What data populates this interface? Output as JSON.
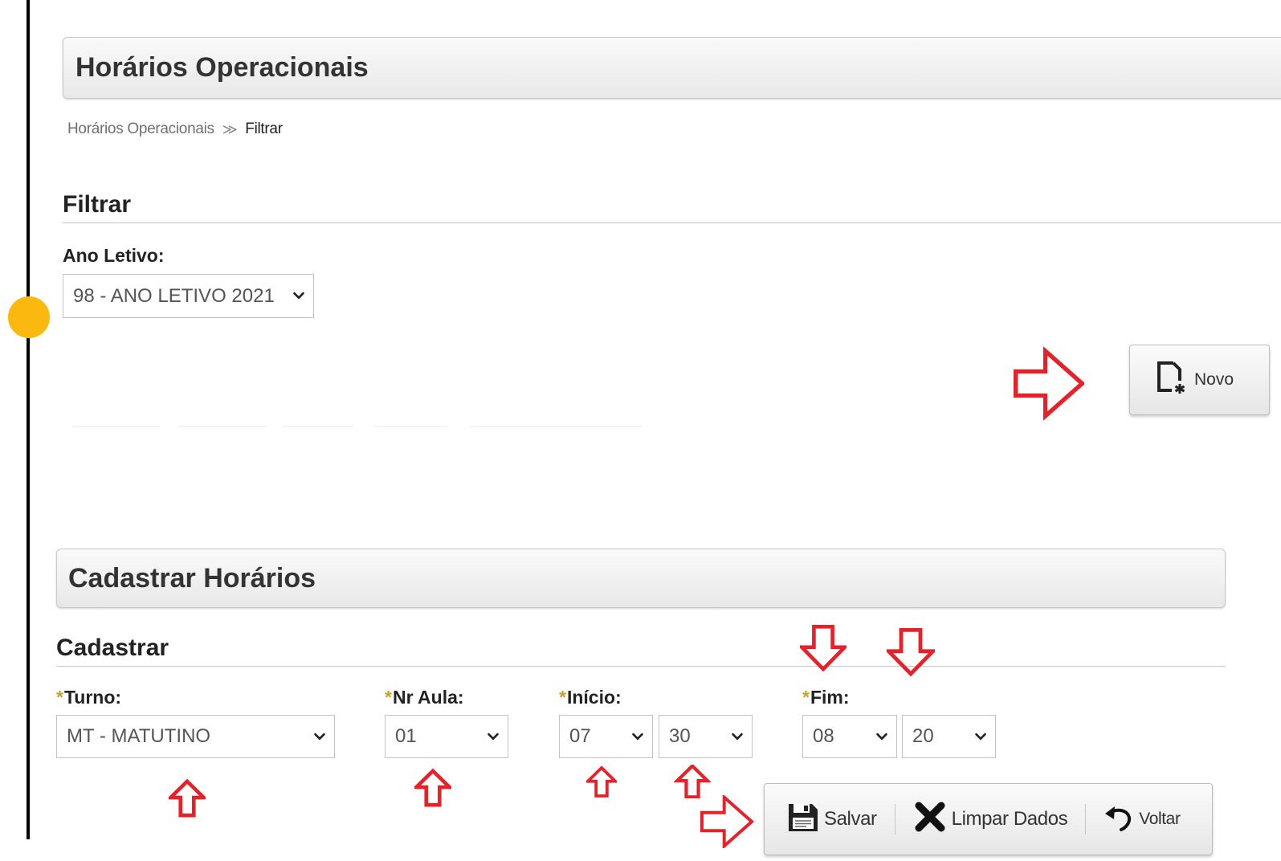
{
  "page": {
    "title": "Horários Operacionais",
    "breadcrumb": {
      "parent": "Horários Operacionais",
      "separator": "≫",
      "current": "Filtrar"
    }
  },
  "filter": {
    "section_title": "Filtrar",
    "ano_letivo": {
      "label": "Ano Letivo:",
      "value": "98 - ANO LETIVO 2021"
    },
    "new_button_label": "Novo"
  },
  "register": {
    "panel_title": "Cadastrar Horários",
    "section_title": "Cadastrar",
    "required_marker": "*",
    "turno": {
      "label": "Turno:",
      "value": "MT - MATUTINO"
    },
    "nr_aula": {
      "label": "Nr Aula:",
      "value": "01"
    },
    "inicio": {
      "label": "Início:",
      "hour": "07",
      "minute": "30"
    },
    "fim": {
      "label": "Fim:",
      "hour": "08",
      "minute": "20"
    },
    "actions": {
      "save": "Salvar",
      "clear": "Limpar Dados",
      "back": "Voltar"
    }
  },
  "colors": {
    "timeline_dot": "#fbb80f",
    "required_star": "#c9a227",
    "annotation_arrow": "#e8202a"
  },
  "icons": {
    "new": "new-document-icon",
    "save": "floppy-disk-icon",
    "clear": "x-mark-icon",
    "back": "undo-arrow-icon",
    "dropdown": "chevron-down-icon",
    "annotation": "red-arrow-icon"
  }
}
